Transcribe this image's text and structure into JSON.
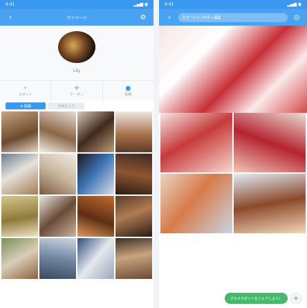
{
  "left": {
    "status": {
      "time": "9:41",
      "right": "▂▄▆ ◼"
    },
    "nav": {
      "back": "‹",
      "title": "マイページ",
      "settings": "⚙"
    },
    "profile": {
      "username": "Lily"
    },
    "tabs": [
      {
        "icon": "⌖",
        "label": "スポット"
      },
      {
        "icon": "✚",
        "label": "クーポン"
      },
      {
        "icon": "●",
        "label": "投稿"
      }
    ],
    "subtabs": {
      "selected": "≡ 投稿",
      "other": "お気に入り"
    }
  },
  "right": {
    "status": {
      "time": "9:41",
      "right": "▂▄▆ ◼"
    },
    "nav": {
      "back": "‹",
      "search": "Q  オーシャン牛タン酒屋",
      "user": "◎"
    },
    "fab": {
      "label": "グルメスポットをシェアしよう！",
      "plus": "+"
    }
  },
  "colors": {
    "accent": "#3a98ee",
    "fab": "#46b96b"
  }
}
